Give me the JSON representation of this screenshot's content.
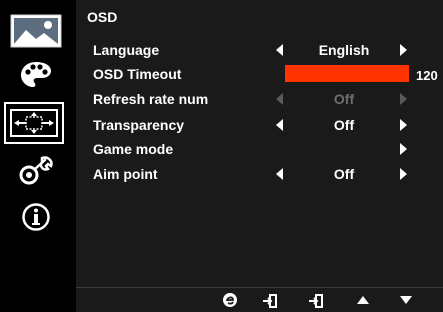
{
  "menu": {
    "title": "OSD",
    "side_icons": [
      "picture-icon",
      "color-palette-icon",
      "osd-icon",
      "settings-icon",
      "info-icon"
    ],
    "selected_side": "osd-icon",
    "items": [
      {
        "label": "Language",
        "value": "English",
        "disabled": false
      },
      {
        "label": "OSD Timeout",
        "value": "120",
        "slider_fraction": 1.0
      },
      {
        "label": "Refresh rate num",
        "value": "Off",
        "disabled": true
      },
      {
        "label": "Transparency",
        "value": "Off",
        "disabled": false
      },
      {
        "label": "Game mode",
        "value": "",
        "disabled": false
      },
      {
        "label": "Aim point",
        "value": "Off",
        "disabled": false
      }
    ],
    "bottom_icons": [
      "eco-icon",
      "enter-icon",
      "exit-icon",
      "up-arrow-icon",
      "down-arrow-icon"
    ]
  },
  "colors": {
    "accent": "#ff3300",
    "panel_bg": "#1a1a1a",
    "text": "#ffffff",
    "disabled_text": "#6e6e6e"
  }
}
